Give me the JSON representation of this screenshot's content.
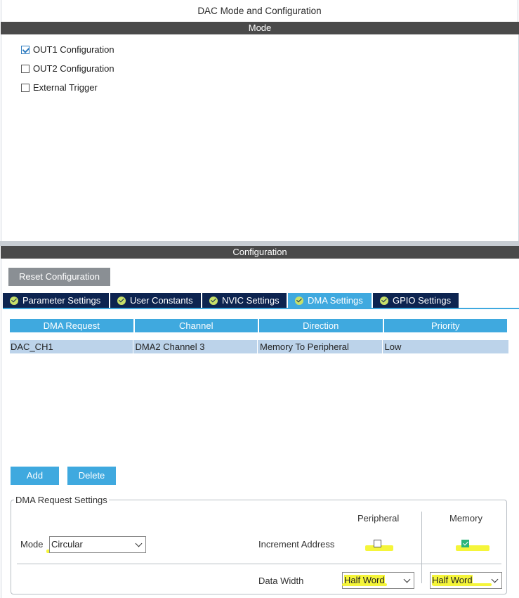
{
  "window": {
    "title": "DAC Mode and Configuration"
  },
  "mode": {
    "section_label": "Mode",
    "options": [
      {
        "label": "OUT1 Configuration",
        "checked": true
      },
      {
        "label": "OUT2 Configuration",
        "checked": false
      },
      {
        "label": "External Trigger",
        "checked": false
      }
    ]
  },
  "configuration": {
    "section_label": "Configuration",
    "reset_button": "Reset Configuration",
    "tabs": [
      {
        "label": "Parameter Settings",
        "active": false
      },
      {
        "label": "User Constants",
        "active": false
      },
      {
        "label": "NVIC Settings",
        "active": false
      },
      {
        "label": "DMA Settings",
        "active": true
      },
      {
        "label": "GPIO Settings",
        "active": false
      }
    ],
    "dma_table": {
      "columns": [
        "DMA Request",
        "Channel",
        "Direction",
        "Priority"
      ],
      "rows": [
        [
          "DAC_CH1",
          "DMA2 Channel 3",
          "Memory To Peripheral",
          "Low"
        ]
      ]
    },
    "add_button": "Add",
    "delete_button": "Delete",
    "request_settings": {
      "legend": "DMA Request Settings",
      "peripheral_header": "Peripheral",
      "memory_header": "Memory",
      "mode_label": "Mode",
      "mode_value": "Circular",
      "increment_label": "Increment Address",
      "increment_peripheral": false,
      "increment_memory": true,
      "data_width_label": "Data Width",
      "data_width_peripheral": "Half Word",
      "data_width_memory": "Half Word"
    }
  },
  "colors": {
    "accent": "#3fa9df",
    "tab_dark": "#0d2450",
    "section_bar": "#4a4a4a",
    "highlight": "#f5f53a"
  }
}
